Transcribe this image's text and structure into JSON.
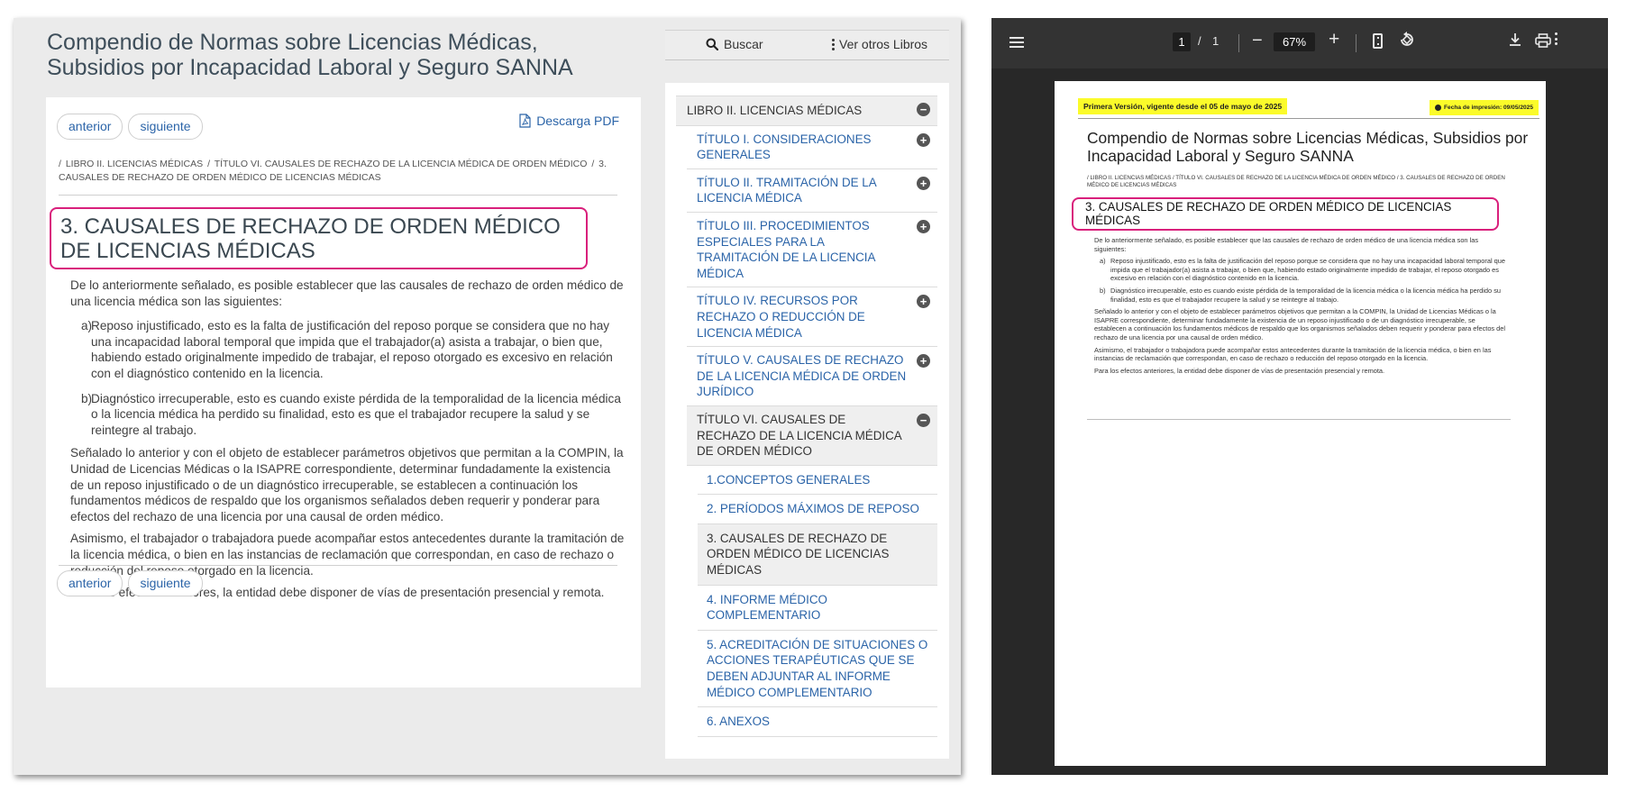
{
  "site": {
    "title": "Compendio de Normas sobre Licencias Médicas, Subsidios por Incapacidad Laboral y Seguro SANNA",
    "search_label": "Buscar",
    "other_books_label": "Ver otros Libros"
  },
  "article": {
    "prev_label": "anterior",
    "next_label": "siguiente",
    "pdf_label": "Descarga PDF",
    "breadcrumb": [
      "LIBRO II. LICENCIAS MÉDICAS",
      "TÍTULO VI. CAUSALES DE RECHAZO DE LA LICENCIA MÉDICA DE ORDEN MÉDICO",
      "3. CAUSALES DE RECHAZO DE ORDEN MÉDICO DE LICENCIAS MÉDICAS"
    ],
    "heading": "3. CAUSALES DE RECHAZO DE ORDEN MÉDICO DE LICENCIAS MÉDICAS",
    "intro": "De lo anteriormente señalado, es posible establecer que las causales de rechazo de orden médico de una licencia médica son las siguientes:",
    "items": [
      {
        "marker": "a)",
        "text": "Reposo injustificado, esto es la falta de justificación del reposo porque se considera que no hay una incapacidad laboral temporal que impida que el trabajador(a) asista a trabajar, o bien que, habiendo estado originalmente impedido de trabajar, el reposo otorgado es excesivo en relación con el diagnóstico contenido en la licencia."
      },
      {
        "marker": "b)",
        "text": "Diagnóstico irrecuperable, esto es cuando existe pérdida de la temporalidad de la licencia médica o la licencia médica ha perdido su finalidad, esto es que el trabajador recupere la salud y se reintegre al trabajo."
      }
    ],
    "paragraphs": [
      "Señalado lo anterior y con el objeto de establecer parámetros objetivos que permitan a la COMPIN, la Unidad de Licencias Médicas o la ISAPRE correspondiente, determinar fundadamente la existencia de un reposo injustificado o de un diagnóstico irrecuperable, se establecen a continuación los fundamentos médicos de respaldo que los organismos señalados deben requerir y ponderar para efectos del rechazo de una licencia por una causal de orden médico.",
      "Asimismo, el trabajador o trabajadora puede acompañar estos antecedentes durante la tramitación de la licencia médica, o bien en las instancias de reclamación que correspondan, en caso de rechazo o reducción del reposo otorgado en la licencia.",
      "Para los efectos anteriores, la entidad debe disponer de vías de presentación presencial y remota."
    ]
  },
  "toc": {
    "book": "LIBRO II. LICENCIAS MÉDICAS",
    "titles": [
      "TÍTULO I. CONSIDERACIONES GENERALES",
      "TÍTULO II. TRAMITACIÓN DE LA LICENCIA MÉDICA",
      "TÍTULO III. PROCEDIMIENTOS ESPECIALES PARA LA TRAMITACIÓN DE LA LICENCIA MÉDICA",
      "TÍTULO IV. RECURSOS POR RECHAZO O REDUCCIÓN DE LICENCIA MÉDICA",
      "TÍTULO V. CAUSALES DE RECHAZO DE LA LICENCIA MÉDICA DE ORDEN JURÍDICO"
    ],
    "open_title": "TÍTULO VI. CAUSALES DE RECHAZO DE LA LICENCIA MÉDICA DE ORDEN MÉDICO",
    "subs": [
      "1.CONCEPTOS GENERALES",
      "2. PERÍODOS MÁXIMOS DE REPOSO",
      "3. CAUSALES DE RECHAZO DE ORDEN MÉDICO DE LICENCIAS MÉDICAS",
      "4. INFORME MÉDICO COMPLEMENTARIO",
      "5. ACREDITACIÓN DE SITUACIONES O ACCIONES TERAPÉUTICAS QUE SE DEBEN ADJUNTAR AL INFORME MÉDICO COMPLEMENTARIO",
      "6. ANEXOS"
    ],
    "expand_symbol": "+",
    "collapse_symbol": "−"
  },
  "viewer": {
    "page_current": "1",
    "page_sep": "/",
    "page_total": "1",
    "zoom": "67%",
    "zoom_out_symbol": "−",
    "zoom_in_symbol": "+",
    "pdf": {
      "version_badge": "Primera Versión, vigente desde el 05 de mayo de 2025",
      "print_date": "Fecha de impresión: 09/05/2025"
    }
  },
  "colors": {
    "link": "#2b64a8",
    "highlight_border": "#d9207c",
    "pdf_badge": "#fbfb2a",
    "viewer_toolbar": "#333333"
  }
}
